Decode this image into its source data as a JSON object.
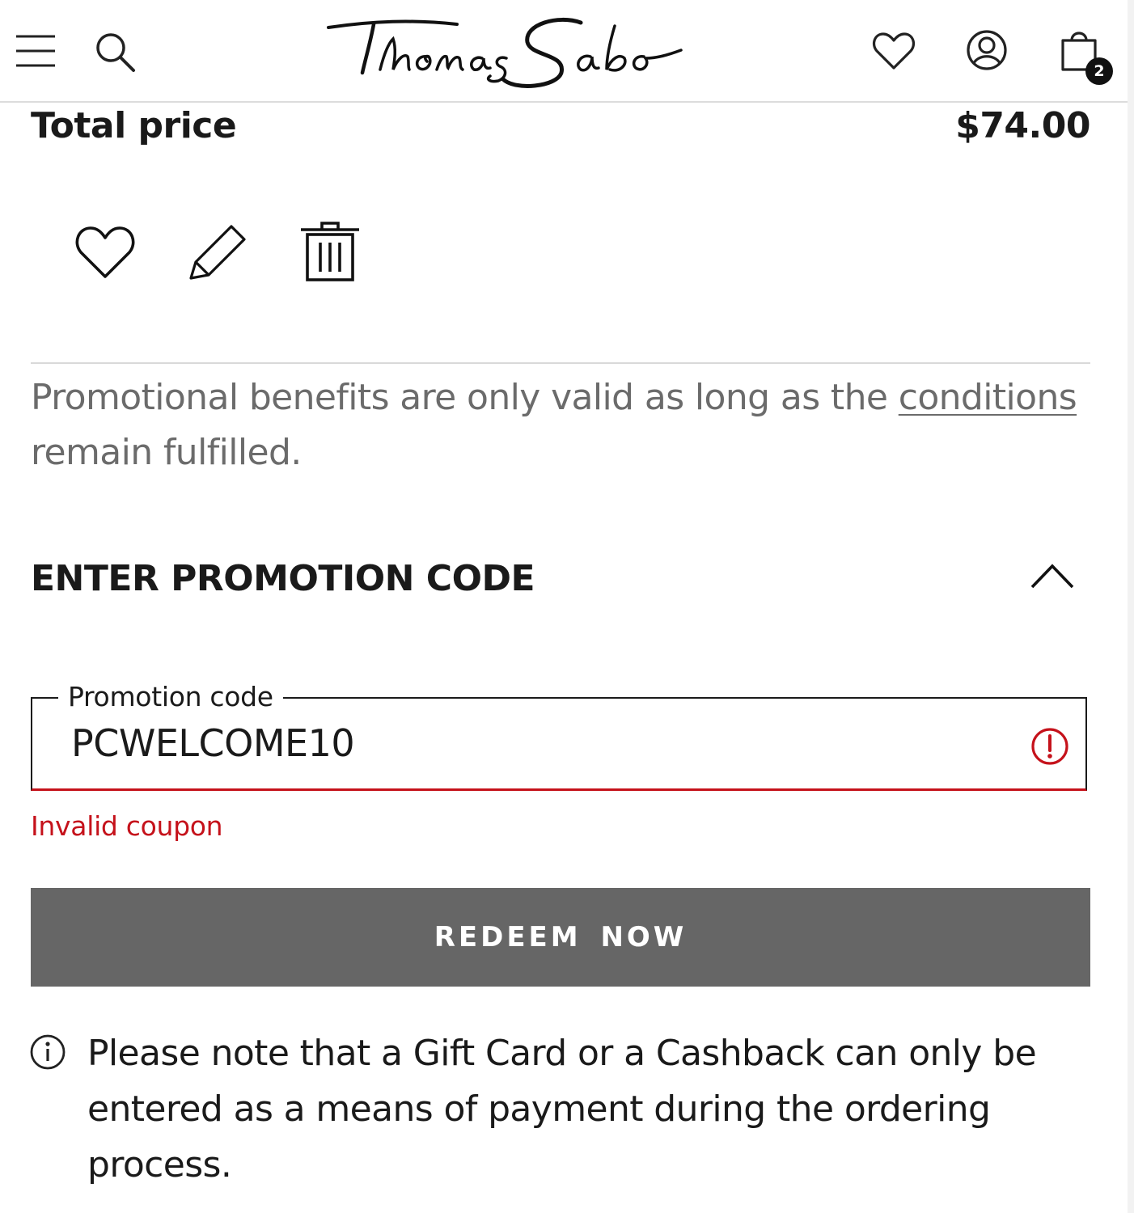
{
  "header": {
    "brand_logo_text": "Thomas Sabo",
    "icons": [
      "menu-icon",
      "search-icon",
      "heart-icon",
      "account-icon",
      "shopping-bag-icon"
    ],
    "cart_count": "2"
  },
  "summary": {
    "total_label": "Total price",
    "total_value": "$74.00"
  },
  "item_actions": {
    "icons": [
      "heart-icon",
      "pencil-icon",
      "trash-icon"
    ]
  },
  "promo_notice": {
    "text_before": "Promotional benefits are only valid as long as the ",
    "link_text": "conditions",
    "text_after": " remain fulfilled."
  },
  "promotion": {
    "heading": "ENTER PROMOTION CODE",
    "field_label": "Promotion code",
    "field_value": "PCWELCOME10",
    "error_message": "Invalid coupon",
    "redeem_label": "REDEEM NOW"
  },
  "info_note": "Please note that a Gift Card or a Cashback can only be entered as a means of payment during the ordering process.",
  "colors": {
    "error": "#c5121b",
    "button_bg": "#666666",
    "muted_text": "#6b6b6b"
  }
}
